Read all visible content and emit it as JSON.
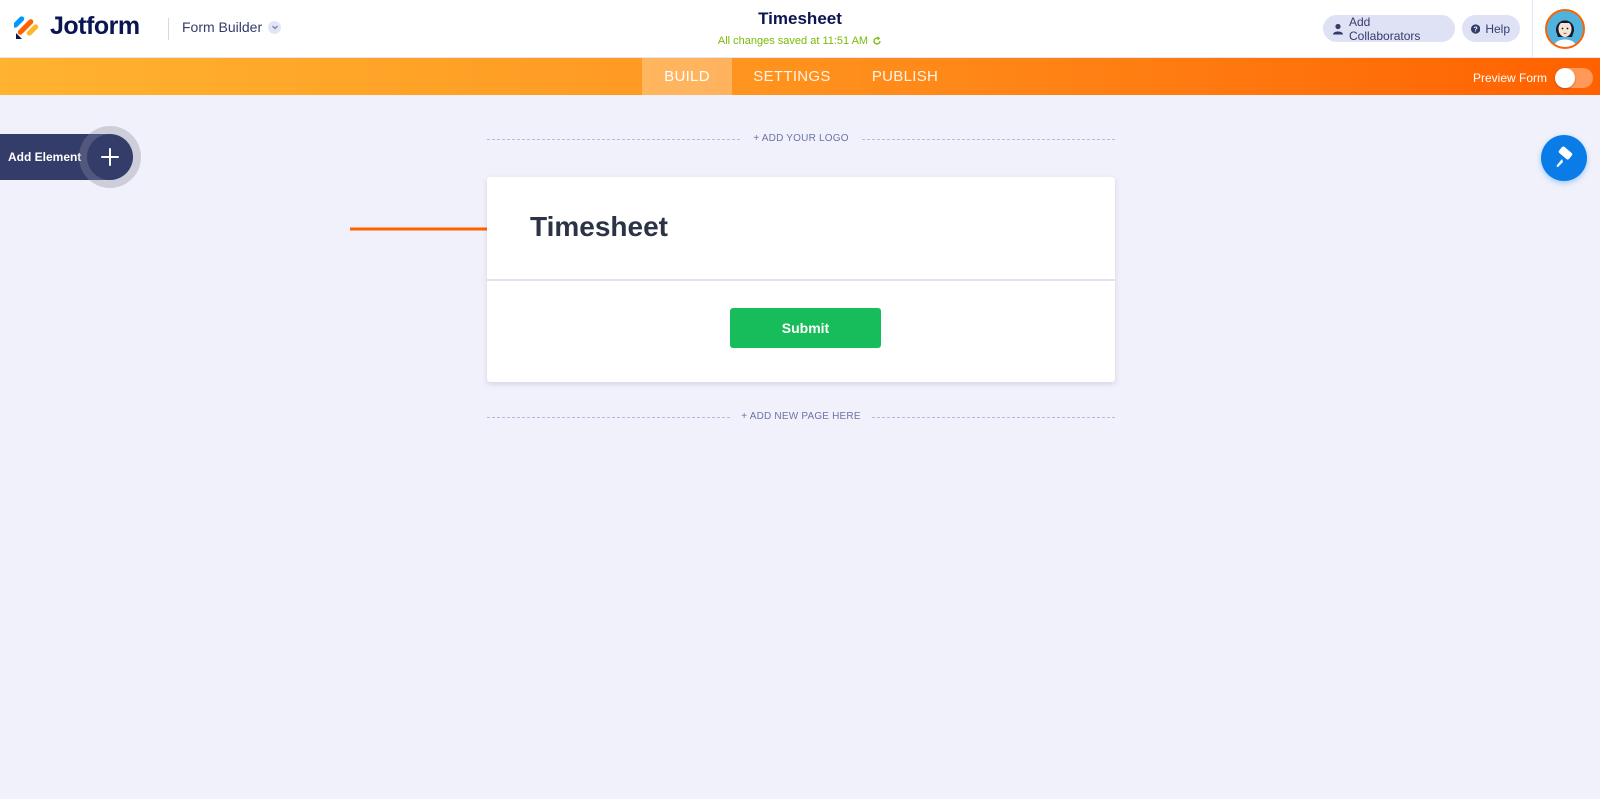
{
  "header": {
    "brand": "Jotform",
    "builder_label": "Form Builder",
    "form_title": "Timesheet",
    "save_status": "All changes saved at 11:51 AM",
    "add_collaborators": "Add Collaborators",
    "help": "Help"
  },
  "nav": {
    "tabs": [
      {
        "label": "BUILD",
        "active": true
      },
      {
        "label": "SETTINGS",
        "active": false
      },
      {
        "label": "PUBLISH",
        "active": false
      }
    ],
    "preview_label": "Preview Form",
    "preview_on": false
  },
  "sidebar": {
    "add_element_label": "Add Element"
  },
  "form": {
    "add_logo": "+ ADD YOUR LOGO",
    "heading": "Timesheet",
    "submit_label": "Submit",
    "add_page": "+ ADD NEW PAGE HERE"
  },
  "colors": {
    "brand_dark": "#0a1551",
    "orange_start": "#ffb330",
    "orange_end": "#ff6100",
    "submit_green": "#18bd5b",
    "designer_blue": "#0a7ce8",
    "arrow_orange": "#ff6100",
    "canvas_bg": "#f1f1fb"
  },
  "icons": {
    "logo": "jotform-logo-icon",
    "builder_chevron": "chevron-down-icon",
    "save_refresh": "refresh-icon",
    "collaborator": "user-icon",
    "help": "question-circle-icon",
    "add": "plus-icon",
    "designer": "paint-roller-icon",
    "annotation": "arrow-right-icon"
  }
}
